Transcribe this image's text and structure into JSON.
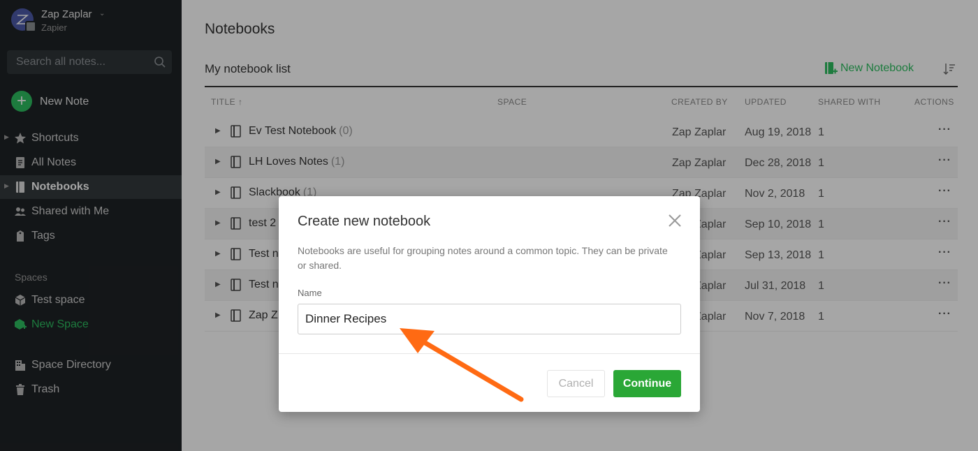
{
  "account": {
    "name": "Zap Zaplar",
    "org": "Zapier"
  },
  "search": {
    "placeholder": "Search all notes..."
  },
  "new_note": {
    "label": "New Note"
  },
  "sidebar": {
    "items": [
      {
        "label": "Shortcuts"
      },
      {
        "label": "All Notes"
      },
      {
        "label": "Notebooks"
      },
      {
        "label": "Shared with Me"
      },
      {
        "label": "Tags"
      }
    ],
    "spaces_heading": "Spaces",
    "spaces": [
      {
        "label": "Test space"
      },
      {
        "label": "New Space"
      }
    ],
    "bottom": [
      {
        "label": "Space Directory"
      },
      {
        "label": "Trash"
      }
    ]
  },
  "main": {
    "page_title": "Notebooks",
    "list_title": "My notebook list",
    "new_notebook_label": "New Notebook",
    "columns": {
      "title": "TITLE ↑",
      "space": "SPACE",
      "created_by": "CREATED BY",
      "updated": "UPDATED",
      "shared_with": "SHARED WITH",
      "actions": "ACTIONS"
    },
    "rows": [
      {
        "name": "Ev Test Notebook",
        "count": "(0)",
        "created_by": "Zap Zaplar",
        "updated": "Aug 19, 2018",
        "shared": "1",
        "actions": "···"
      },
      {
        "name": "LH Loves Notes",
        "count": "(1)",
        "created_by": "Zap Zaplar",
        "updated": "Dec 28, 2018",
        "shared": "1",
        "actions": "···"
      },
      {
        "name": "Slackbook",
        "count": "(1)",
        "created_by": "Zap Zaplar",
        "updated": "Nov 2, 2018",
        "shared": "1",
        "actions": "···"
      },
      {
        "name": "test 2",
        "count": "",
        "created_by": "Zap Zaplar",
        "updated": "Sep 10, 2018",
        "shared": "1",
        "actions": "···"
      },
      {
        "name": "Test n",
        "count": "",
        "created_by": "Zap Zaplar",
        "updated": "Sep 13, 2018",
        "shared": "1",
        "actions": "···"
      },
      {
        "name": "Test n",
        "count": "",
        "created_by": "Zap Zaplar",
        "updated": "Jul 31, 2018",
        "shared": "1",
        "actions": "···"
      },
      {
        "name": "Zap Z",
        "count": "",
        "created_by": "Zap Zaplar",
        "updated": "Nov 7, 2018",
        "shared": "1",
        "actions": "···"
      }
    ]
  },
  "modal": {
    "title": "Create new notebook",
    "description": "Notebooks are useful for grouping notes around a common topic. They can be private or shared.",
    "name_label": "Name",
    "name_value": "Dinner Recipes",
    "cancel_label": "Cancel",
    "continue_label": "Continue"
  },
  "colors": {
    "accent_green": "#2dbe60",
    "continue_green": "#2aa736",
    "annotation_arrow": "#ff6a13",
    "sidebar_bg": "#1e2225"
  },
  "icons": [
    "search-icon",
    "plus-icon",
    "star-icon",
    "note-icon",
    "notebook-icon",
    "people-icon",
    "tag-icon",
    "cube-icon",
    "building-icon",
    "trash-icon",
    "sort-icon",
    "close-icon"
  ]
}
